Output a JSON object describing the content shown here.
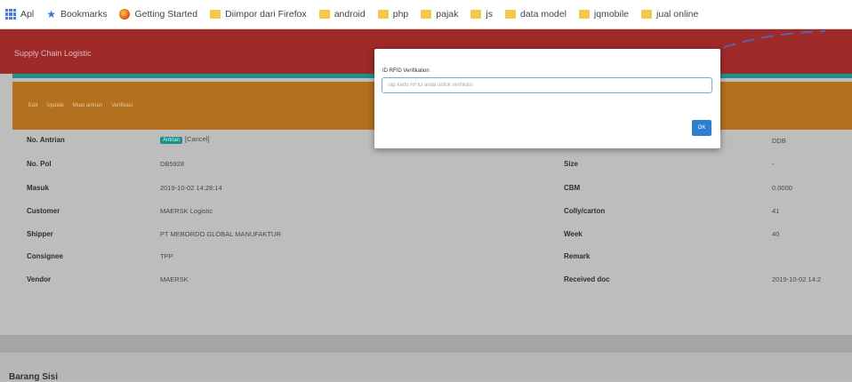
{
  "bookmarks": [
    {
      "icon": "apps-grid-icon",
      "label": "Apl"
    },
    {
      "icon": "star-icon",
      "label": "Bookmarks"
    },
    {
      "icon": "firefox-icon",
      "label": "Getting Started"
    },
    {
      "icon": "folder-icon",
      "label": "Diimpor dari Firefox"
    },
    {
      "icon": "folder-icon",
      "label": "android"
    },
    {
      "icon": "folder-icon",
      "label": "php"
    },
    {
      "icon": "folder-icon",
      "label": "pajak"
    },
    {
      "icon": "folder-icon",
      "label": "js"
    },
    {
      "icon": "folder-icon",
      "label": "data model"
    },
    {
      "icon": "folder-icon",
      "label": "jqmobile"
    },
    {
      "icon": "folder-icon",
      "label": "jual online"
    }
  ],
  "header": {
    "title": "Supply Chain Logistic"
  },
  "toolbar": {
    "links": [
      "Edit",
      "Update",
      "Muat antrian",
      "Verifikasi"
    ]
  },
  "left_rows": [
    {
      "label": "No. Antrian",
      "value": "[Cancel]",
      "badge": "Antrian"
    },
    {
      "label": "No. Pol",
      "value": "DB5928"
    },
    {
      "label": "Masuk",
      "value": "2019-10-02 14:28:14"
    },
    {
      "label": "Customer",
      "value": "MAERSK Logistic"
    },
    {
      "label": "Shipper",
      "value": "PT MEBORDO GLOBAL MANUFAKTUR"
    },
    {
      "label": "Consignee",
      "value": "TPP"
    },
    {
      "label": "Vendor",
      "value": "MAERSK"
    }
  ],
  "right_rows": [
    {
      "label": "",
      "value": "DDB"
    },
    {
      "label": "Size",
      "value": "-"
    },
    {
      "label": "CBM",
      "value": "0.0000"
    },
    {
      "label": "Colly/carton",
      "value": "41"
    },
    {
      "label": "Week",
      "value": "40"
    },
    {
      "label": "Remark",
      "value": ""
    },
    {
      "label": "Received doc",
      "value": "2019-10-02 14:2"
    }
  ],
  "section2": {
    "title": "Barang Sisi"
  },
  "modal": {
    "label": "ID RFID Verifikation",
    "placeholder": "Tap kartu RFID anda untuk verifikasi",
    "ok_label": "OK"
  },
  "colors": {
    "header": "#9e2a2a",
    "toolbar": "#b3701e",
    "accent": "#1f8f8c",
    "ok": "#2f7fd0"
  }
}
